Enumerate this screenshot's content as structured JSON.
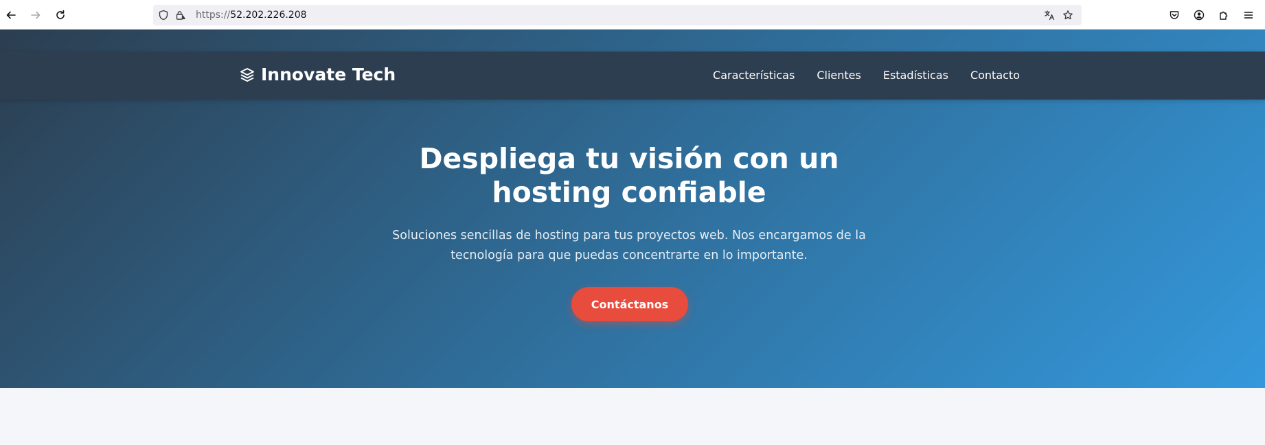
{
  "browser": {
    "url_scheme": "https://",
    "url_host": "52.202.226.208"
  },
  "navbar": {
    "brand": "Innovate Tech",
    "links": [
      {
        "label": "Características"
      },
      {
        "label": "Clientes"
      },
      {
        "label": "Estadísticas"
      },
      {
        "label": "Contacto"
      }
    ]
  },
  "hero": {
    "title": "Despliega tu visión con un hosting confiable",
    "subtitle": "Soluciones sencillas de hosting para tus proyectos web. Nos encargamos de la tecnología para que puedas concentrarte en lo importante.",
    "cta_label": "Contáctanos"
  },
  "colors": {
    "nav_bg": "#2d3e50",
    "gradient_start": "#2c3e50",
    "gradient_end": "#3498db",
    "cta": "#e74c3c",
    "page_bg": "#f5f6fa"
  },
  "icons": {
    "back": "arrow-left-icon",
    "forward": "arrow-right-icon",
    "reload": "reload-icon",
    "tracking": "shield-icon",
    "lock": "lock-warning-icon",
    "translate": "translate-icon",
    "bookmark": "star-icon",
    "pocket": "pocket-icon",
    "account": "account-icon",
    "extensions": "puzzle-icon",
    "menu": "hamburger-icon",
    "brand": "layers-icon"
  }
}
